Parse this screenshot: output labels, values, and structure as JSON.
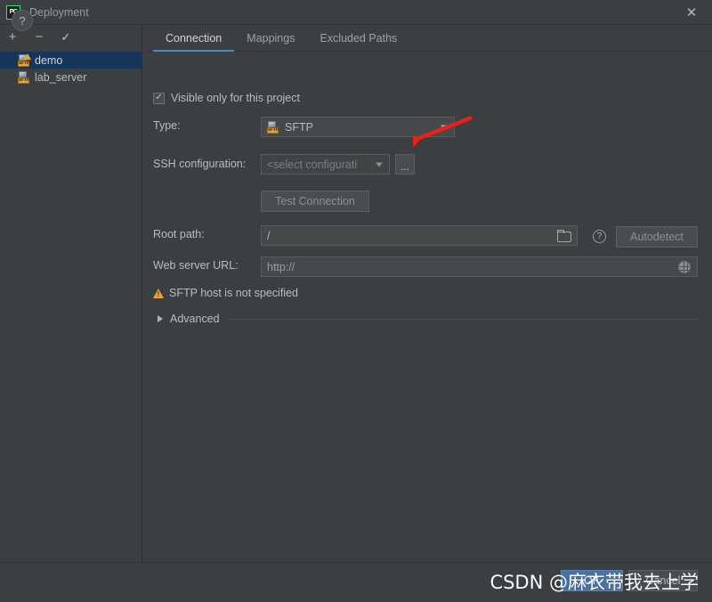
{
  "window": {
    "title": "Deployment",
    "logo_text": "PC",
    "close_label": "✕"
  },
  "sidebar": {
    "toolbar": [
      {
        "name": "add",
        "glyph": "+"
      },
      {
        "name": "remove",
        "glyph": "−"
      },
      {
        "name": "set-default",
        "glyph": "✓"
      }
    ],
    "items": [
      {
        "label": "demo",
        "icon": "sftp-server-warning-icon",
        "selected": true
      },
      {
        "label": "lab_server",
        "icon": "sftp-server-icon",
        "selected": false
      }
    ]
  },
  "tabs": [
    {
      "label": "Connection",
      "active": true
    },
    {
      "label": "Mappings",
      "active": false
    },
    {
      "label": "Excluded Paths",
      "active": false
    }
  ],
  "form": {
    "visible_only_checkbox": {
      "label": "Visible only for this project",
      "checked": true,
      "check_glyph": "✓"
    },
    "type": {
      "label": "Type:",
      "value": "SFTP",
      "icon": "sftp-type-icon",
      "badge": "SFTP"
    },
    "ssh_configuration": {
      "label": "SSH configuration:",
      "value": "<select configurati",
      "browse_button": "...",
      "disabled": true
    },
    "test_connection": {
      "label": "Test Connection",
      "disabled": true
    },
    "root_path": {
      "label": "Root path:",
      "value": "/",
      "browse_icon": "folder-icon",
      "help_icon": "help-circle-icon",
      "help_glyph": "?",
      "autodetect_label": "Autodetect"
    },
    "web_server_url": {
      "label": "Web server URL:",
      "value": "http://",
      "open_icon": "globe-icon"
    },
    "warning": {
      "text": "SFTP host is not specified",
      "icon": "warning-triangle-icon"
    },
    "advanced": {
      "label": "Advanced",
      "expanded": false,
      "icon": "chevron-right-icon"
    }
  },
  "annotation": {
    "arrow": "red-arrow-pointing-left",
    "color": "#e8211c"
  },
  "footer": {
    "help_glyph": "?",
    "ok_label": "OK",
    "cancel_label": "Cancel"
  },
  "watermark": {
    "text": "CSDN @麻衣带我去上学"
  },
  "colors": {
    "background": "#3c3f41",
    "selection": "#14365b",
    "accent": "#4a88c7",
    "warning": "#e8a33d",
    "annotation": "#e8211c",
    "ok_button": "#4a71a1"
  }
}
